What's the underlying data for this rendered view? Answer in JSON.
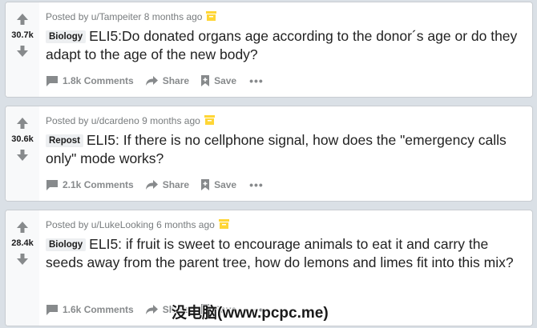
{
  "posts": [
    {
      "score": "30.7k",
      "posted_by": "Posted by u/Tampeiter 8 months ago",
      "flair": "Biology",
      "title": "ELI5:Do donated organs age according to the donor´s age or do they adapt to the age of the new body?",
      "comments": "1.8k Comments",
      "share": "Share",
      "save": "Save",
      "more": "•••"
    },
    {
      "score": "30.6k",
      "posted_by": "Posted by u/dcardeno 9 months ago",
      "flair": "Repost",
      "title": "ELI5: If there is no cellphone signal, how does the \"emergency calls only\" mode works?",
      "comments": "2.1k Comments",
      "share": "Share",
      "save": "Save",
      "more": "•••"
    },
    {
      "score": "28.4k",
      "posted_by": "Posted by u/LukeLooking 6 months ago",
      "flair": "Biology",
      "title": "ELI5: if fruit is sweet to encourage animals to eat it and carry the seeds away from the parent tree, how do lemons and limes fit into this mix?",
      "comments": "1.6k Comments",
      "share": "Share",
      "save": "Save",
      "more": "•••"
    }
  ],
  "watermark": "没电脑(www.pcpc.me)",
  "colors": {
    "page_bg": "#dae0e6",
    "card_bg": "#ffffff",
    "vote_bg": "#f8f9fa",
    "meta_text": "#787c7e",
    "archive_icon": "#ffd635",
    "action_text": "#878a8c"
  },
  "icons": [
    "upvote-icon",
    "downvote-icon",
    "archive-icon",
    "comment-icon",
    "share-icon",
    "save-icon"
  ]
}
